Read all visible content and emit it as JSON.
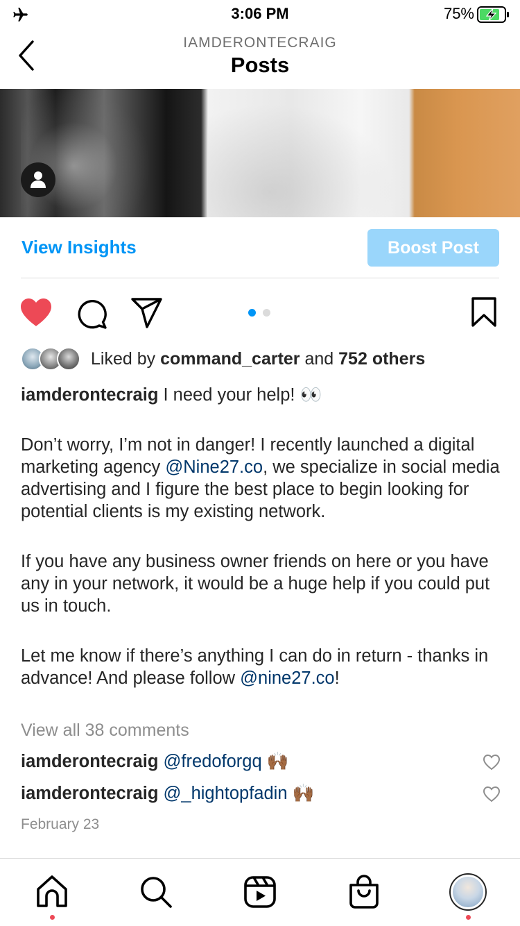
{
  "status_bar": {
    "time": "3:06 PM",
    "battery_percent": "75%",
    "icons": [
      "airplane-icon",
      "battery-charging-icon"
    ]
  },
  "header": {
    "owner": "IAMDERONTECRAIG",
    "title": "Posts",
    "back_icon": "chevron-left-icon"
  },
  "post": {
    "tag_icon": "person-icon",
    "view_insights": "View Insights",
    "boost_post": "Boost Post",
    "carousel": {
      "count": 2,
      "active": 1
    },
    "liked_by_prefix": "Liked by ",
    "liked_by_user": "command_carter",
    "liked_by_and": " and ",
    "liked_by_others": "752 others",
    "caption": {
      "author": "iamderontecraig",
      "line1": " I need your help! 👀",
      "p2_part1": "Don’t worry, I’m not in danger! I recently launched a digital marketing agency ",
      "p2_mention": "@Nine27.co",
      "p2_part2": ", we specialize in social media advertising and I figure the best place to begin looking for potential clients is my existing network.",
      "p3": "If you have any business owner friends on here or you have any in your network, it would be a huge help if you could put us in touch.",
      "p4_part1": "Let me know if there’s anything I can do in return - thanks in advance! And please follow ",
      "p4_mention": "@nine27.co",
      "p4_part2": "!"
    },
    "view_all_comments": "View all 38 comments",
    "comments": [
      {
        "user": "iamderontecraig",
        "mention": "@fredoforgq",
        "emoji": "🙌🏾"
      },
      {
        "user": "iamderontecraig",
        "mention": "@_hightopfadin",
        "emoji": "🙌🏾"
      }
    ],
    "date": "February 23"
  },
  "colors": {
    "accent": "#0095f6",
    "boost_bg": "#9ad6fb",
    "like_red": "#ed4956",
    "mention": "#00376b",
    "muted": "#8e8e8e"
  },
  "tabbar": [
    "home-icon",
    "search-icon",
    "reels-icon",
    "shop-icon",
    "profile-avatar"
  ]
}
